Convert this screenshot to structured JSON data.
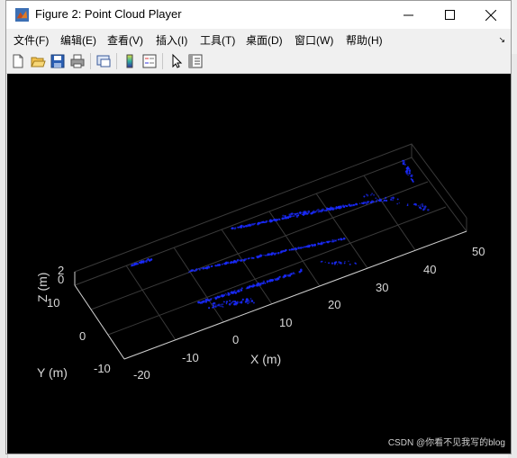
{
  "window": {
    "title": "Figure 2: Point Cloud Player"
  },
  "menu": {
    "items": [
      "文件(F)",
      "编辑(E)",
      "查看(V)",
      "插入(I)",
      "工具(T)",
      "桌面(D)",
      "窗口(W)",
      "帮助(H)"
    ]
  },
  "toolbar": {
    "icons": [
      "new-figure-icon",
      "open-file-icon",
      "save-icon",
      "print-icon",
      "link-plot-icon",
      "colorbar-icon",
      "legend-icon",
      "pointer-icon",
      "property-inspector-icon"
    ]
  },
  "plot": {
    "axis_labels": {
      "x": "X (m)",
      "y": "Y (m)",
      "z": "Z (m)"
    },
    "x_ticks": [
      "-20",
      "-10",
      "0",
      "10",
      "20",
      "30",
      "40",
      "50"
    ],
    "y_ticks": [
      "-10",
      "0",
      "10"
    ],
    "z_ticks": [
      "0",
      "2"
    ],
    "point_color": "#1a2bff",
    "background": "#000000"
  },
  "watermark": "CSDN @你看不见我写的blog",
  "colors": {
    "titlebar": "#ffffff",
    "chrome": "#f0f0f0"
  }
}
